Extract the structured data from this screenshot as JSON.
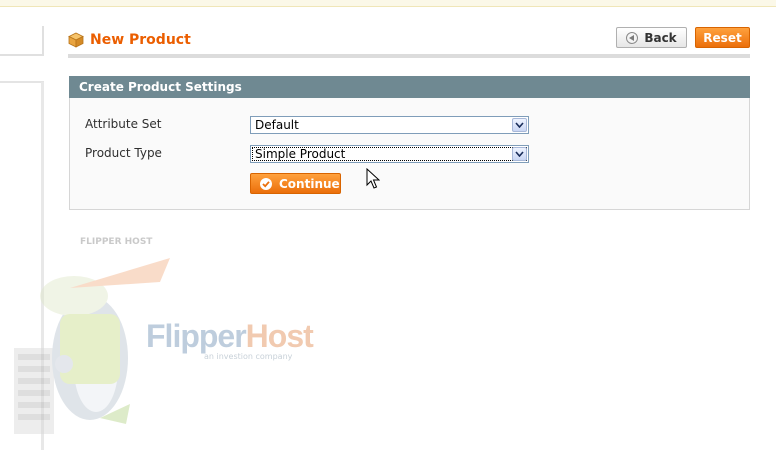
{
  "page": {
    "title": "New Product",
    "back_label": "Back",
    "reset_label": "Reset"
  },
  "settings_panel": {
    "heading": "Create Product Settings",
    "attribute_set": {
      "label": "Attribute Set",
      "value": "Default"
    },
    "product_type": {
      "label": "Product Type",
      "value": "Simple Product"
    },
    "continue_label": "Continue"
  },
  "watermark": {
    "brand_left": "Flipper",
    "brand_right": "Host",
    "tagline": "an investion company",
    "cap_text": "FLIPPER HOST"
  },
  "colors": {
    "accent_orange": "#eb5e00",
    "button_orange": "#f18200",
    "panel_header": "#6f8992"
  },
  "icons": {
    "title_icon": "product-box-icon",
    "back_icon": "back-arrow-icon",
    "continue_icon": "checkmark-icon",
    "dropdown_icon": "chevron-down-icon"
  }
}
